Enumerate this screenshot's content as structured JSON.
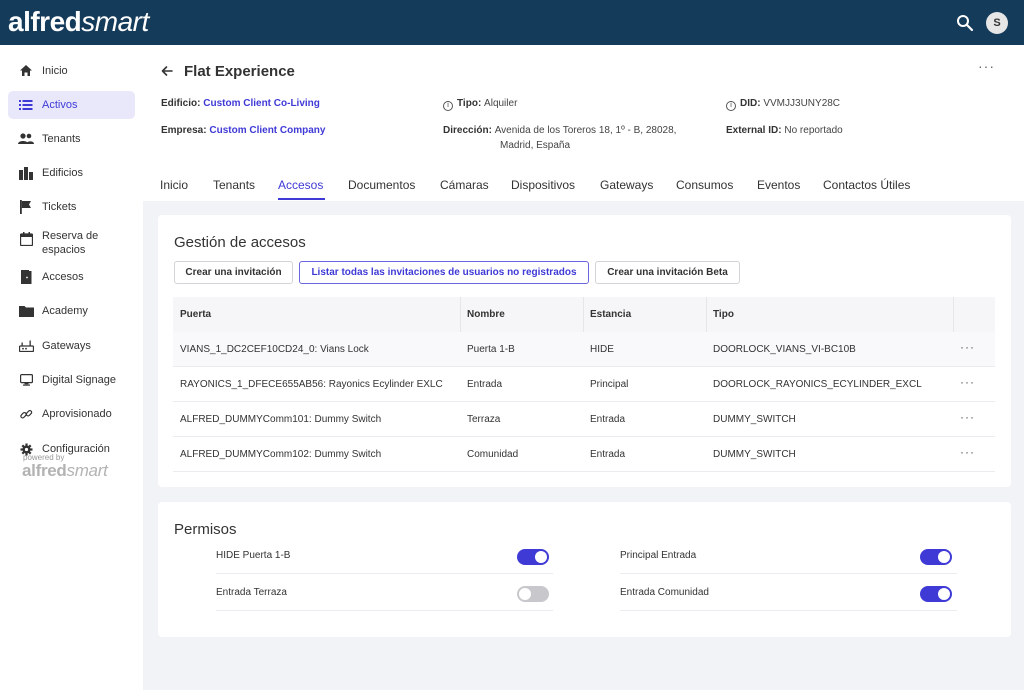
{
  "brand": {
    "bold": "alfred",
    "light": "smart"
  },
  "header": {
    "avatar_initial": "S"
  },
  "sidebar": {
    "items": [
      {
        "label": "Inicio",
        "icon": "home-icon"
      },
      {
        "label": "Activos",
        "icon": "list-icon",
        "active": true
      },
      {
        "label": "Tenants",
        "icon": "people-icon"
      },
      {
        "label": "Edificios",
        "icon": "buildings-icon"
      },
      {
        "label": "Tickets",
        "icon": "flag-icon"
      },
      {
        "label": "Reserva de espacios",
        "icon": "calendar-icon"
      },
      {
        "label": "Accesos",
        "icon": "door-icon"
      },
      {
        "label": "Academy",
        "icon": "folder-icon"
      },
      {
        "label": "Gateways",
        "icon": "router-icon"
      },
      {
        "label": "Digital Signage",
        "icon": "monitor-icon"
      },
      {
        "label": "Aprovisionado",
        "icon": "link-icon"
      },
      {
        "label": "Configuración",
        "icon": "gear-icon"
      }
    ],
    "powered_by": "powered by"
  },
  "page": {
    "title": "Flat Experience",
    "edificio_label": "Edificio",
    "edificio_value": "Custom Client Co-Living",
    "empresa_label": "Empresa",
    "empresa_value": "Custom Client Company",
    "tipo_label": "Tipo",
    "tipo_value": "Alquiler",
    "direccion_label": "Dirección",
    "direccion_line1": "Avenida de los Toreros 18, 1º - B, 28028,",
    "direccion_line2": "Madrid, España",
    "did_label": "DID",
    "did_value": "VVMJJ3UNY28C",
    "external_label": "External ID",
    "external_value": "No reportado"
  },
  "tabs": [
    "Inicio",
    "Tenants",
    "Accesos",
    "Documentos",
    "Cámaras",
    "Dispositivos",
    "Gateways",
    "Consumos",
    "Eventos",
    "Contactos Útiles"
  ],
  "accesos": {
    "title": "Gestión de accesos",
    "btn_create": "Crear una invitación",
    "btn_list": "Listar todas las invitaciones de usuarios no registrados",
    "btn_beta": "Crear una invitación Beta",
    "columns": [
      "Puerta",
      "Nombre",
      "Estancia",
      "Tipo"
    ],
    "rows": [
      [
        "VIANS_1_DC2CEF10CD24_0: Vians Lock",
        "Puerta 1-B",
        "HIDE",
        "DOORLOCK_VIANS_VI-BC10B"
      ],
      [
        "RAYONICS_1_DFECE655AB56: Rayonics Ecylinder EXLC",
        "Entrada",
        "Principal",
        "DOORLOCK_RAYONICS_ECYLINDER_EXCL"
      ],
      [
        "ALFRED_DUMMYComm101: Dummy Switch",
        "Terraza",
        "Entrada",
        "DUMMY_SWITCH"
      ],
      [
        "ALFRED_DUMMYComm102: Dummy Switch",
        "Comunidad",
        "Entrada",
        "DUMMY_SWITCH"
      ]
    ]
  },
  "permisos": {
    "title": "Permisos",
    "items": [
      {
        "label": "HIDE Puerta 1-B",
        "on": true
      },
      {
        "label": "Principal Entrada",
        "on": true
      },
      {
        "label": "Entrada Terraza",
        "on": false
      },
      {
        "label": "Entrada Comunidad",
        "on": true
      }
    ]
  },
  "colors": {
    "header": "#153b5b",
    "accent": "#3f3ad6"
  }
}
